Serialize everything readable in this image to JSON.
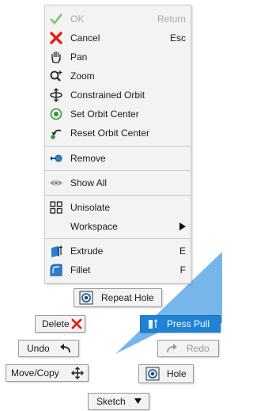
{
  "menu": {
    "ok": {
      "label": "OK",
      "shortcut": "Return",
      "icon": "checkmark-icon"
    },
    "cancel": {
      "label": "Cancel",
      "shortcut": "Esc",
      "icon": "red-x-icon"
    },
    "pan": {
      "label": "Pan",
      "icon": "hand-icon"
    },
    "zoom": {
      "label": "Zoom",
      "icon": "zoom-icon"
    },
    "constrained_orbit": {
      "label": "Constrained Orbit",
      "icon": "orbit-icon"
    },
    "set_orbit_center": {
      "label": "Set Orbit Center",
      "icon": "target-icon"
    },
    "reset_orbit_center": {
      "label": "Reset Orbit Center",
      "icon": "reset-icon"
    },
    "remove": {
      "label": "Remove",
      "icon": "remove-icon"
    },
    "show_all": {
      "label": "Show All",
      "icon": "eye-icon"
    },
    "unisolate": {
      "label": "Unisolate",
      "icon": "grid-icon"
    },
    "workspace": {
      "label": "Workspace",
      "icon": "submenu-arrow-icon"
    },
    "extrude": {
      "label": "Extrude",
      "shortcut": "E",
      "icon": "extrude-icon"
    },
    "fillet": {
      "label": "Fillet",
      "shortcut": "F",
      "icon": "fillet-icon"
    }
  },
  "marking": {
    "repeat_hole": "Repeat Hole",
    "delete": "Delete",
    "press_pull": "Press Pull",
    "undo": "Undo",
    "redo": "Redo",
    "move_copy": "Move/Copy",
    "hole": "Hole",
    "sketch": "Sketch"
  },
  "colors": {
    "accent_blue": "#1f82d6",
    "wedge_blue": "#5fa9e6",
    "cancel_red": "#e0201a",
    "ok_green": "#7ec470"
  }
}
